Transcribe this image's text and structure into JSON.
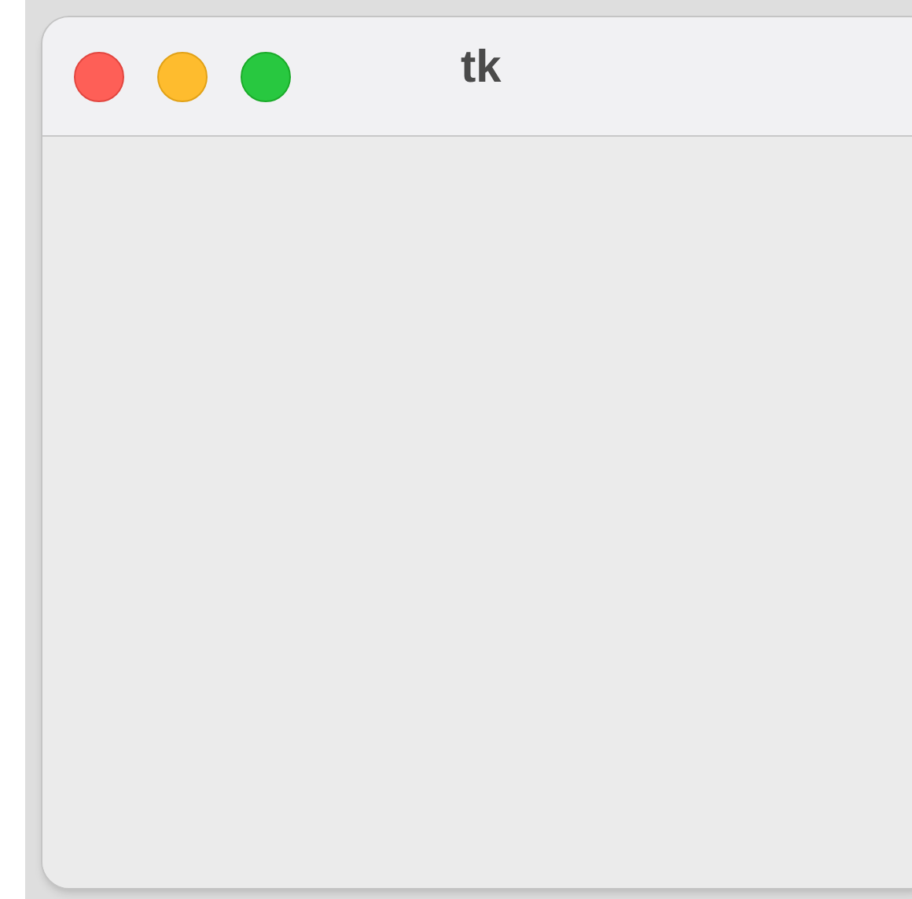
{
  "window": {
    "title": "tk"
  }
}
